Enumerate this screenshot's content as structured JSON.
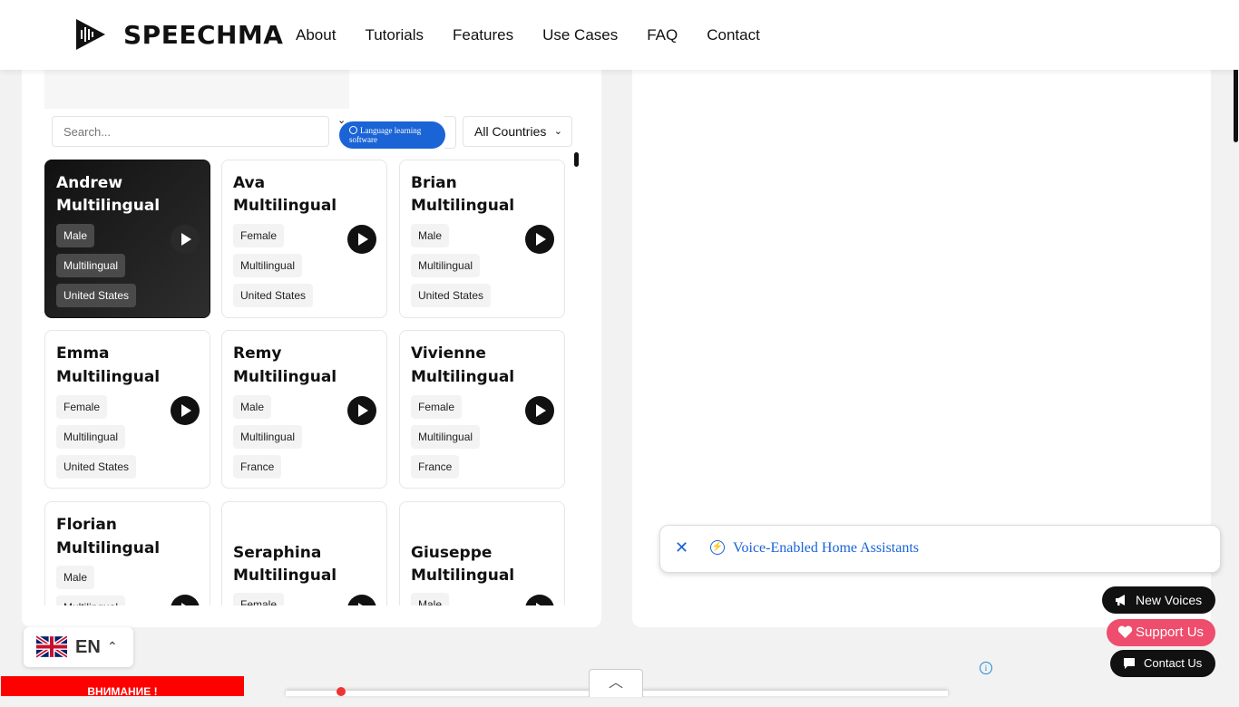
{
  "brand": "SPEECHMA",
  "nav": [
    "About",
    "Tutorials",
    "Features",
    "Use Cases",
    "FAQ",
    "Contact"
  ],
  "search": {
    "placeholder": "Search..."
  },
  "category_pill": "Language learning software",
  "country_filter": "All Countries",
  "voices": [
    {
      "name": "Andrew",
      "model": "Multilingual",
      "gender": "Male",
      "lang": "Multilingual",
      "country": "United States"
    },
    {
      "name": "Ava",
      "model": "Multilingual",
      "gender": "Female",
      "lang": "Multilingual",
      "country": "United States"
    },
    {
      "name": "Brian",
      "model": "Multilingual",
      "gender": "Male",
      "lang": "Multilingual",
      "country": "United States"
    },
    {
      "name": "Emma",
      "model": "Multilingual",
      "gender": "Female",
      "lang": "Multilingual",
      "country": "United States"
    },
    {
      "name": "Remy",
      "model": "Multilingual",
      "gender": "Male",
      "lang": "Multilingual",
      "country": "France"
    },
    {
      "name": "Vivienne",
      "model": "Multilingual",
      "gender": "Female",
      "lang": "Multilingual",
      "country": "France"
    },
    {
      "name": "Florian",
      "model": "Multilingual",
      "gender": "Male",
      "lang": "Multilingual",
      "country": ""
    },
    {
      "name": "Seraphina",
      "model": "Multilingual",
      "gender": "Female",
      "lang": "",
      "country": ""
    },
    {
      "name": "Giuseppe",
      "model": "Multilingual",
      "gender": "Male",
      "lang": "",
      "country": ""
    }
  ],
  "toast": {
    "text": "Voice-Enabled Home Assistants"
  },
  "buttons": {
    "new_voices": "New Voices",
    "support": "Support Us",
    "contact": "Contact Us"
  },
  "language_switcher": {
    "code": "EN"
  },
  "warning_banner": "ВНИМАНИЕ !",
  "colors": {
    "accent": "#1a64d6",
    "support": "#ee4d6d",
    "dark": "#111111",
    "warning": "#ff0000"
  }
}
